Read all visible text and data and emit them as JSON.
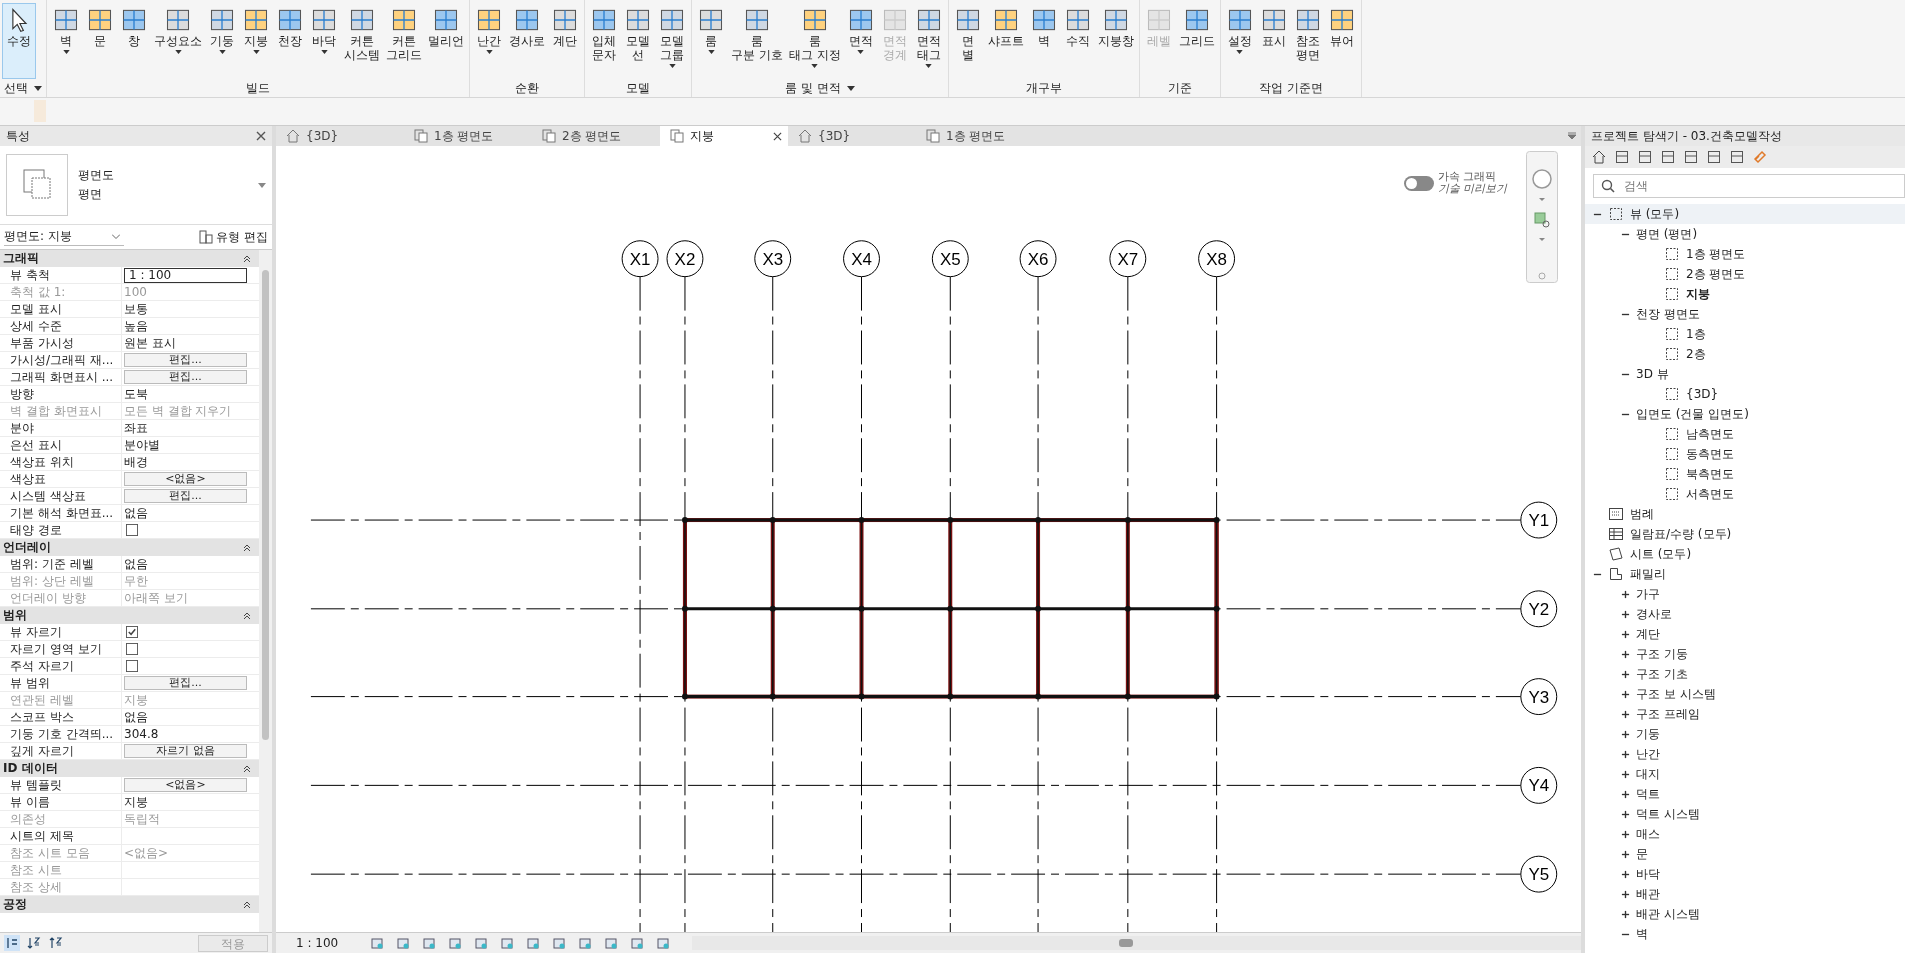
{
  "ribbon": {
    "select": {
      "button": {
        "label": "수정",
        "selected": true
      },
      "title": "선택",
      "menu": true
    },
    "panels": [
      {
        "title": "빌드",
        "menu": false,
        "buttons": [
          {
            "label": "벽",
            "menu": true,
            "disabled": false
          },
          {
            "label": "문",
            "menu": false,
            "disabled": false
          },
          {
            "label": "창",
            "menu": false,
            "disabled": false
          },
          {
            "label": "구성요소",
            "menu": true,
            "disabled": false
          },
          {
            "label": "기둥",
            "menu": true,
            "disabled": false
          },
          {
            "label": "지붕",
            "menu": true,
            "disabled": false
          },
          {
            "label": "천장",
            "menu": false,
            "disabled": false
          },
          {
            "label": "바닥",
            "menu": true,
            "disabled": false
          },
          {
            "label": "커튼\n시스템",
            "menu": false,
            "disabled": false
          },
          {
            "label": "커튼\n그리드",
            "menu": false,
            "disabled": false
          },
          {
            "label": "멀리언",
            "menu": false,
            "disabled": false
          }
        ]
      },
      {
        "title": "순환",
        "menu": false,
        "buttons": [
          {
            "label": "난간",
            "menu": true,
            "disabled": false
          },
          {
            "label": "경사로",
            "menu": false,
            "disabled": false
          },
          {
            "label": "계단",
            "menu": false,
            "disabled": false
          }
        ]
      },
      {
        "title": "모델",
        "menu": false,
        "buttons": [
          {
            "label": "입체\n문자",
            "menu": false,
            "disabled": false
          },
          {
            "label": "모델\n선",
            "menu": false,
            "disabled": false
          },
          {
            "label": "모델\n그룹",
            "menu": true,
            "disabled": false
          }
        ]
      },
      {
        "title": "룸 및 면적",
        "menu": true,
        "buttons": [
          {
            "label": "룸",
            "menu": true,
            "disabled": false
          },
          {
            "label": "룸\n구분 기호",
            "menu": false,
            "disabled": false
          },
          {
            "label": "룸\n태그 지정",
            "menu": true,
            "disabled": false
          },
          {
            "label": "면적",
            "menu": true,
            "disabled": false
          },
          {
            "label": "면적\n경계",
            "menu": false,
            "disabled": true
          },
          {
            "label": "면적\n태그",
            "menu": true,
            "disabled": false
          }
        ]
      },
      {
        "title": "개구부",
        "menu": false,
        "buttons": [
          {
            "label": "면\n별",
            "menu": false,
            "disabled": false
          },
          {
            "label": "샤프트",
            "menu": false,
            "disabled": false
          },
          {
            "label": "벽",
            "menu": false,
            "disabled": false
          },
          {
            "label": "수직",
            "menu": false,
            "disabled": false
          },
          {
            "label": "지붕창",
            "menu": false,
            "disabled": false
          }
        ]
      },
      {
        "title": "기준",
        "menu": false,
        "buttons": [
          {
            "label": "레벨",
            "menu": false,
            "disabled": true
          },
          {
            "label": "그리드",
            "menu": false,
            "disabled": false
          }
        ]
      },
      {
        "title": "작업 기준면",
        "menu": false,
        "buttons": [
          {
            "label": "설정",
            "menu": true,
            "disabled": false
          },
          {
            "label": "표시",
            "menu": false,
            "disabled": false
          },
          {
            "label": "참조\n평면",
            "menu": false,
            "disabled": false
          },
          {
            "label": "뷰어",
            "menu": false,
            "disabled": false
          }
        ]
      }
    ]
  },
  "properties": {
    "title": "특성",
    "type_line1": "평면도",
    "type_line2": "평면",
    "instance": "평면도: 지붕",
    "edit_type": "유형 편집",
    "groups": [
      {
        "title": "그래픽",
        "rows": [
          {
            "label": "뷰 축척",
            "value": "1 : 100",
            "kind": "input",
            "disabled": false
          },
          {
            "label": "축척 값    1:",
            "value": "100",
            "kind": "text",
            "disabled": true
          },
          {
            "label": "모델 표시",
            "value": "보통",
            "kind": "text",
            "disabled": false
          },
          {
            "label": "상세 수준",
            "value": "높음",
            "kind": "text",
            "disabled": false
          },
          {
            "label": "부품 가시성",
            "value": "원본 표시",
            "kind": "text",
            "disabled": false
          },
          {
            "label": "가시성/그래픽 재...",
            "value": "편집...",
            "kind": "button",
            "disabled": false
          },
          {
            "label": "그래픽 화면표시 ...",
            "value": "편집...",
            "kind": "button",
            "disabled": false
          },
          {
            "label": "방향",
            "value": "도북",
            "kind": "text",
            "disabled": false
          },
          {
            "label": "벽 결합 화면표시",
            "value": "모든 벽 결합 지우기",
            "kind": "text",
            "disabled": true
          },
          {
            "label": "분야",
            "value": "좌표",
            "kind": "text",
            "disabled": false
          },
          {
            "label": "은선 표시",
            "value": "분야별",
            "kind": "text",
            "disabled": false
          },
          {
            "label": "색상표 위치",
            "value": "배경",
            "kind": "text",
            "disabled": false
          },
          {
            "label": "색상표",
            "value": "<없음>",
            "kind": "button",
            "disabled": false
          },
          {
            "label": "시스템 색상표",
            "value": "편집...",
            "kind": "button",
            "disabled": false
          },
          {
            "label": "기본 해석 화면표...",
            "value": "없음",
            "kind": "text",
            "disabled": false
          },
          {
            "label": "태양 경로",
            "kind": "check",
            "checked": false,
            "disabled": false
          }
        ]
      },
      {
        "title": "언더레이",
        "rows": [
          {
            "label": "범위: 기준 레벨",
            "value": "없음",
            "kind": "text",
            "disabled": false
          },
          {
            "label": "범위: 상단 레벨",
            "value": "무한",
            "kind": "text",
            "disabled": true
          },
          {
            "label": "언더레이 방향",
            "value": "아래쪽 보기",
            "kind": "text",
            "disabled": true
          }
        ]
      },
      {
        "title": "범위",
        "rows": [
          {
            "label": "뷰 자르기",
            "kind": "check",
            "checked": true,
            "disabled": false
          },
          {
            "label": "자르기 영역 보기",
            "kind": "check",
            "checked": false,
            "disabled": false
          },
          {
            "label": "주석 자르기",
            "kind": "check",
            "checked": false,
            "disabled": false
          },
          {
            "label": "뷰 범위",
            "value": "편집...",
            "kind": "button",
            "disabled": false
          },
          {
            "label": "연관된 레벨",
            "value": "지붕",
            "kind": "text",
            "disabled": true
          },
          {
            "label": "스코프 박스",
            "value": "없음",
            "kind": "text",
            "disabled": false
          },
          {
            "label": "기둥 기호 간격띄...",
            "value": "304.8",
            "kind": "text",
            "disabled": false
          },
          {
            "label": "깊게 자르기",
            "value": "자르기 없음",
            "kind": "button",
            "disabled": false
          }
        ]
      },
      {
        "title": "ID 데이터",
        "rows": [
          {
            "label": "뷰 템플릿",
            "value": "<없음>",
            "kind": "button",
            "disabled": false
          },
          {
            "label": "뷰 이름",
            "value": "지붕",
            "kind": "text",
            "disabled": false
          },
          {
            "label": "의존성",
            "value": "독립적",
            "kind": "text",
            "disabled": true
          },
          {
            "label": "시트의 제목",
            "kind": "text",
            "disabled": false
          },
          {
            "label": "참조 시트 모음",
            "value": "<없음>",
            "kind": "text",
            "disabled": true
          },
          {
            "label": "참조 시트",
            "kind": "text",
            "disabled": true
          },
          {
            "label": "참조 상세",
            "kind": "text",
            "disabled": true
          }
        ]
      },
      {
        "title": "공정"
      }
    ],
    "apply": "적용"
  },
  "tabs": [
    {
      "label": "{3D}",
      "kind": "model",
      "selected": false
    },
    {
      "label": "1층 평면도",
      "kind": "plan",
      "selected": false
    },
    {
      "label": "2층 평면도",
      "kind": "plan",
      "selected": false
    },
    {
      "label": "지붕",
      "kind": "plan",
      "selected": true
    },
    {
      "label": "{3D}",
      "kind": "model",
      "selected": false
    },
    {
      "label": "1층 평면도",
      "kind": "plan",
      "selected": false
    }
  ],
  "canvas": {
    "accel": {
      "label": "가속 그래픽",
      "sublabel": "기술 미리보기",
      "on": false
    },
    "grids": {
      "vertical": [
        "X1",
        "X2",
        "X3",
        "X4",
        "X5",
        "X6",
        "X7",
        "X8"
      ],
      "horizontal": [
        "Y1",
        "Y2",
        "Y3",
        "Y4",
        "Y5"
      ]
    }
  },
  "status_bar": {
    "scale": "1 : 100"
  },
  "browser": {
    "title": "프로젝트 탐색기 - 03.건축모델작성",
    "search": {
      "placeholder": "검색"
    },
    "tree": [
      {
        "label": "뷰 (모두)",
        "kind": "views",
        "expanded": true,
        "children": [
          {
            "label": "평면 (평면)",
            "expanded": true,
            "children": [
              {
                "label": "1층 평면도",
                "kind": "view",
                "active": false
              },
              {
                "label": "2층 평면도",
                "kind": "view",
                "active": false
              },
              {
                "label": "지붕",
                "kind": "view",
                "active": true
              }
            ]
          },
          {
            "label": "천장 평면도",
            "expanded": true,
            "children": [
              {
                "label": "1층",
                "kind": "view",
                "active": false
              },
              {
                "label": "2층",
                "kind": "view",
                "active": false
              }
            ]
          },
          {
            "label": "3D 뷰",
            "expanded": true,
            "children": [
              {
                "label": "{3D}",
                "kind": "view",
                "active": false
              }
            ]
          },
          {
            "label": "입면도 (건물 입면도)",
            "expanded": true,
            "children": [
              {
                "label": "남측면도",
                "kind": "view",
                "active": false
              },
              {
                "label": "동측면도",
                "kind": "view",
                "active": false
              },
              {
                "label": "북측면도",
                "kind": "view",
                "active": false
              },
              {
                "label": "서측면도",
                "kind": "view",
                "active": false
              }
            ]
          }
        ]
      },
      {
        "label": "범례",
        "kind": "legend"
      },
      {
        "label": "일람표/수량 (모두)",
        "kind": "schedule"
      },
      {
        "label": "시트 (모두)",
        "kind": "sheet"
      },
      {
        "label": "패밀리",
        "kind": "family",
        "expanded": true,
        "children": [
          {
            "label": "가구",
            "expanded": false
          },
          {
            "label": "경사로",
            "expanded": false
          },
          {
            "label": "계단",
            "expanded": false
          },
          {
            "label": "구조 기둥",
            "expanded": false
          },
          {
            "label": "구조 기초",
            "expanded": false
          },
          {
            "label": "구조 보 시스템",
            "expanded": false
          },
          {
            "label": "구조 프레임",
            "expanded": false
          },
          {
            "label": "기둥",
            "expanded": false
          },
          {
            "label": "난간",
            "expanded": false
          },
          {
            "label": "대지",
            "expanded": false
          },
          {
            "label": "덕트",
            "expanded": false
          },
          {
            "label": "덕트 시스템",
            "expanded": false
          },
          {
            "label": "매스",
            "expanded": false
          },
          {
            "label": "문",
            "expanded": false
          },
          {
            "label": "바닥",
            "expanded": false
          },
          {
            "label": "배관",
            "expanded": false
          },
          {
            "label": "배관 시스템",
            "expanded": false
          },
          {
            "label": "벽",
            "expanded": true
          }
        ]
      }
    ]
  }
}
